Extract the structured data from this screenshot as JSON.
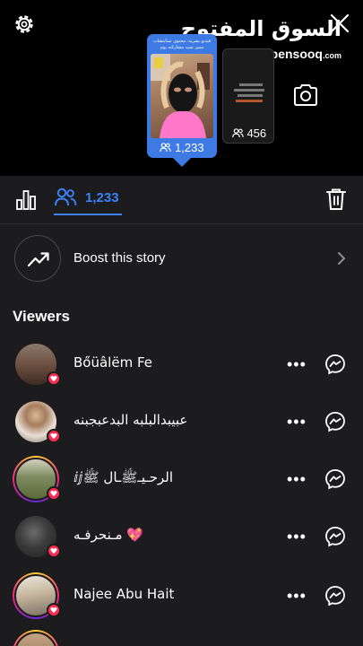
{
  "watermark": {
    "arabic": "السوق المفتوح",
    "domain": "opensooq",
    "tld": ".com"
  },
  "story": {
    "main_caption": "فيديو بشرية: محتوى سنابتشات مميز تمت مشاركته يوم",
    "main_views": "1,233",
    "second_views": "456"
  },
  "tabs": {
    "viewers_count": "1,233"
  },
  "boost": {
    "label": "Boost this story"
  },
  "viewers": {
    "heading": "Viewers",
    "items": [
      {
        "name": "Bőüâlëm Fe"
      },
      {
        "name": "عبيبدالبلبه البدعبجبنه"
      },
      {
        "name": "ⅈⅉالرحـيـﷺـال ﷺ"
      },
      {
        "name": "مـنحرفـه 💖"
      },
      {
        "name": "Najee Abu Hait"
      }
    ]
  },
  "colors": {
    "accent": "#3b82f6",
    "like": "#ff2d55",
    "thumb_border": "#3d7ae3"
  }
}
